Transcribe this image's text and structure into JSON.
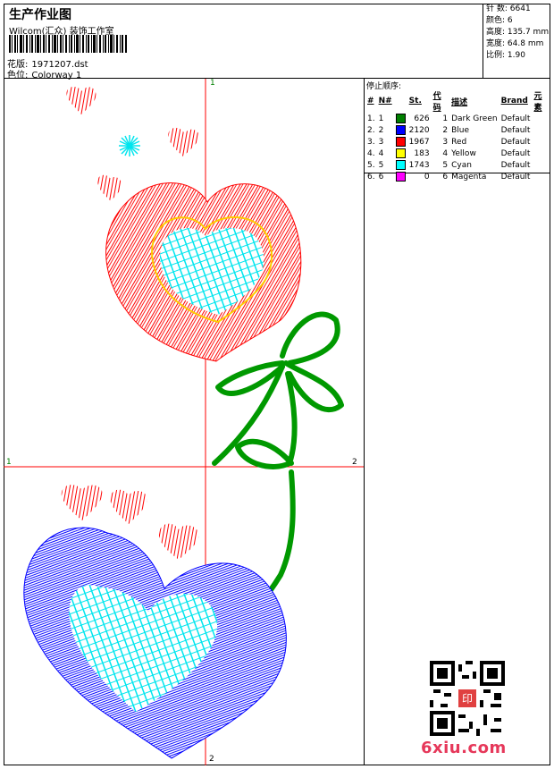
{
  "header": {
    "title": "生产作业图",
    "company": "Wilcom(汇众) 装饰工作室",
    "design_label": "花版:",
    "design_value": "1971207.dst",
    "colorway_label": "色位:",
    "colorway_value": "Colorway 1"
  },
  "stats": [
    {
      "label": "针 数:",
      "value": "6641"
    },
    {
      "label": "颜色:",
      "value": "6"
    },
    {
      "label": "高度:",
      "value": "135.7 mm"
    },
    {
      "label": "宽度:",
      "value": "64.8 mm"
    },
    {
      "label": "比例:",
      "value": "1.90"
    }
  ],
  "stop_sequence": {
    "title": "停止顺序:",
    "headers": [
      "#",
      "N#",
      "St.",
      "代码",
      "描述",
      "Brand",
      "元素"
    ],
    "rows": [
      {
        "idx": "1.",
        "n": "1",
        "color": "#008000",
        "st": "626",
        "code": "1",
        "desc": "Dark Green",
        "brand": "Default"
      },
      {
        "idx": "2.",
        "n": "2",
        "color": "#0000ff",
        "st": "2120",
        "code": "2",
        "desc": "Blue",
        "brand": "Default"
      },
      {
        "idx": "3.",
        "n": "3",
        "color": "#ff0000",
        "st": "1967",
        "code": "3",
        "desc": "Red",
        "brand": "Default"
      },
      {
        "idx": "4.",
        "n": "4",
        "color": "#ffff00",
        "st": "183",
        "code": "4",
        "desc": "Yellow",
        "brand": "Default"
      },
      {
        "idx": "5.",
        "n": "5",
        "color": "#00ffff",
        "st": "1743",
        "code": "5",
        "desc": "Cyan",
        "brand": "Default"
      },
      {
        "idx": "6.",
        "n": "6",
        "color": "#ff00ff",
        "st": "0",
        "code": "6",
        "desc": "Magenta",
        "brand": "Default"
      }
    ]
  },
  "canvas": {
    "top_marker": "1",
    "left_marker": "1",
    "right_marker": "2",
    "bottom_marker": "2",
    "guide_color": "#ff0000"
  },
  "watermark": {
    "site": "6xiu.com",
    "stamp": "印"
  }
}
